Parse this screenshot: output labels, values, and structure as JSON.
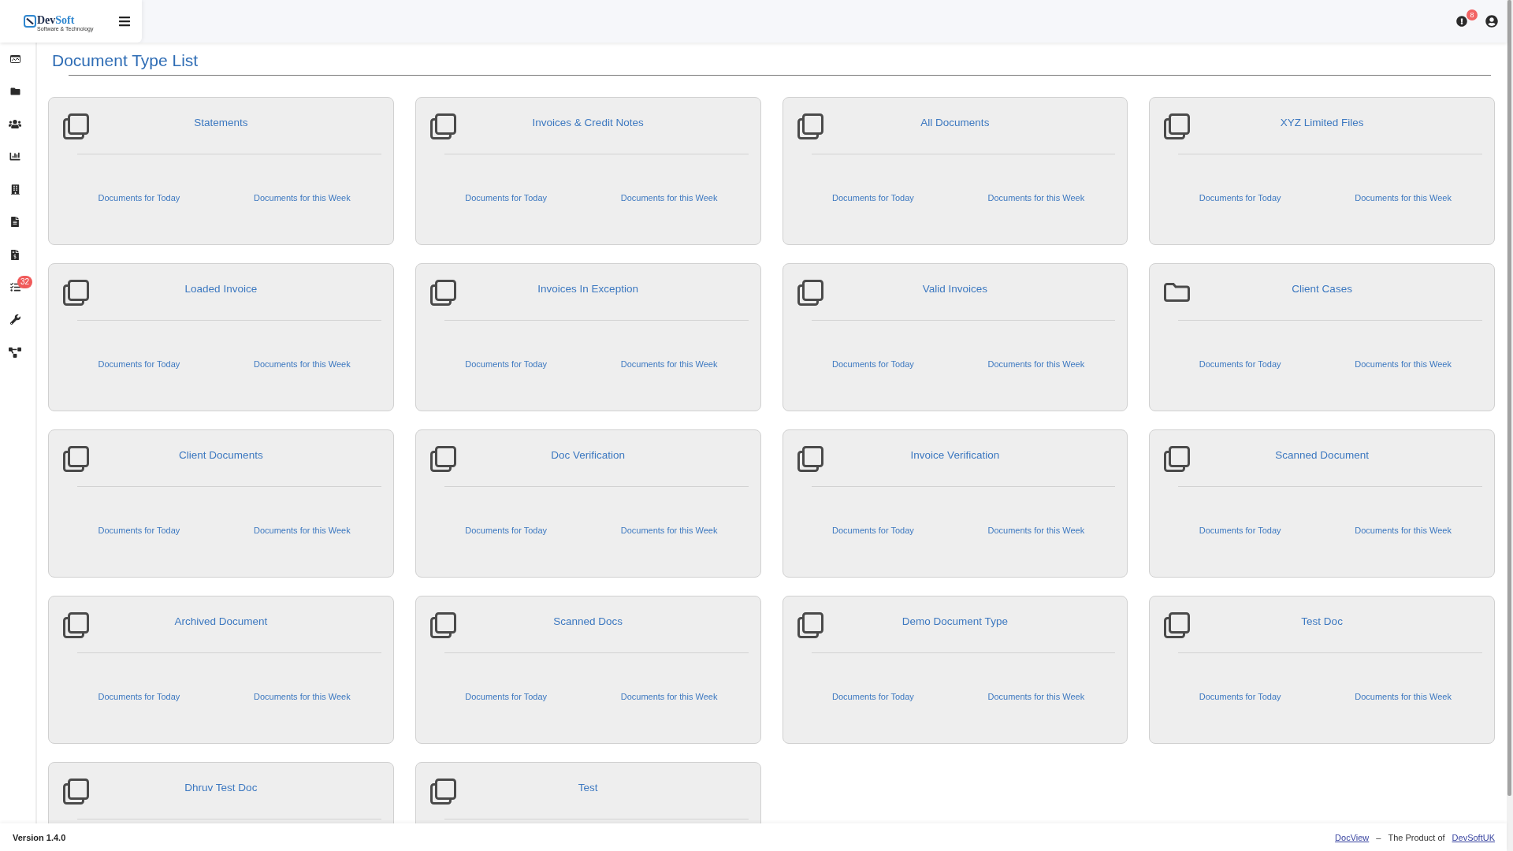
{
  "header": {
    "logo": {
      "parts": [
        "Dev",
        "Soft"
      ],
      "tagline": "Software & Technology"
    },
    "alert_badge": "8"
  },
  "sidebar": {
    "items": [
      {
        "kind": "dashboard"
      },
      {
        "kind": "folder"
      },
      {
        "kind": "users"
      },
      {
        "kind": "chart"
      },
      {
        "kind": "building"
      },
      {
        "kind": "file"
      },
      {
        "kind": "invoice"
      },
      {
        "kind": "tasks",
        "badge": "32"
      },
      {
        "kind": "wrench"
      },
      {
        "kind": "diagram"
      }
    ]
  },
  "page": {
    "title": "Document Type List"
  },
  "cards": [
    {
      "kind": "documents",
      "title": "Statements",
      "links": [
        "Documents for Today",
        "Documents for this Week"
      ]
    },
    {
      "kind": "documents",
      "title": "Invoices & Credit Notes",
      "links": [
        "Documents for Today",
        "Documents for this Week"
      ]
    },
    {
      "kind": "documents",
      "title": "All Documents",
      "links": [
        "Documents for Today",
        "Documents for this Week"
      ]
    },
    {
      "kind": "documents",
      "title": "XYZ Limited Files",
      "links": [
        "Documents for Today",
        "Documents for this Week"
      ]
    },
    {
      "kind": "documents",
      "title": "Loaded Invoice",
      "links": [
        "Documents for Today",
        "Documents for this Week"
      ]
    },
    {
      "kind": "documents",
      "title": "Invoices In Exception",
      "links": [
        "Documents for Today",
        "Documents for this Week"
      ]
    },
    {
      "kind": "documents",
      "title": "Valid Invoices",
      "links": [
        "Documents for Today",
        "Documents for this Week"
      ]
    },
    {
      "kind": "folder",
      "title": "Client Cases",
      "links": [
        "Documents for Today",
        "Documents for this Week"
      ]
    },
    {
      "kind": "documents",
      "title": "Client Documents",
      "links": [
        "Documents for Today",
        "Documents for this Week"
      ]
    },
    {
      "kind": "documents",
      "title": "Doc Verification",
      "links": [
        "Documents for Today",
        "Documents for this Week"
      ]
    },
    {
      "kind": "documents",
      "title": "Invoice Verification",
      "links": [
        "Documents for Today",
        "Documents for this Week"
      ]
    },
    {
      "kind": "documents",
      "title": "Scanned Document",
      "links": [
        "Documents for Today",
        "Documents for this Week"
      ]
    },
    {
      "kind": "documents",
      "title": "Archived Document",
      "links": [
        "Documents for Today",
        "Documents for this Week"
      ]
    },
    {
      "kind": "documents",
      "title": "Scanned Docs",
      "links": [
        "Documents for Today",
        "Documents for this Week"
      ]
    },
    {
      "kind": "documents",
      "title": "Demo Document Type",
      "links": [
        "Documents for Today",
        "Documents for this Week"
      ]
    },
    {
      "kind": "documents",
      "title": "Test Doc",
      "links": [
        "Documents for Today",
        "Documents for this Week"
      ]
    },
    {
      "kind": "documents",
      "title": "Dhruv Test Doc"
    },
    {
      "kind": "documents",
      "title": "Test"
    }
  ],
  "footer": {
    "version": "Version 1.4.0",
    "product_link": "DocView",
    "separator": "–",
    "credit": "The Product of",
    "company_link": "DevSoftUK"
  }
}
